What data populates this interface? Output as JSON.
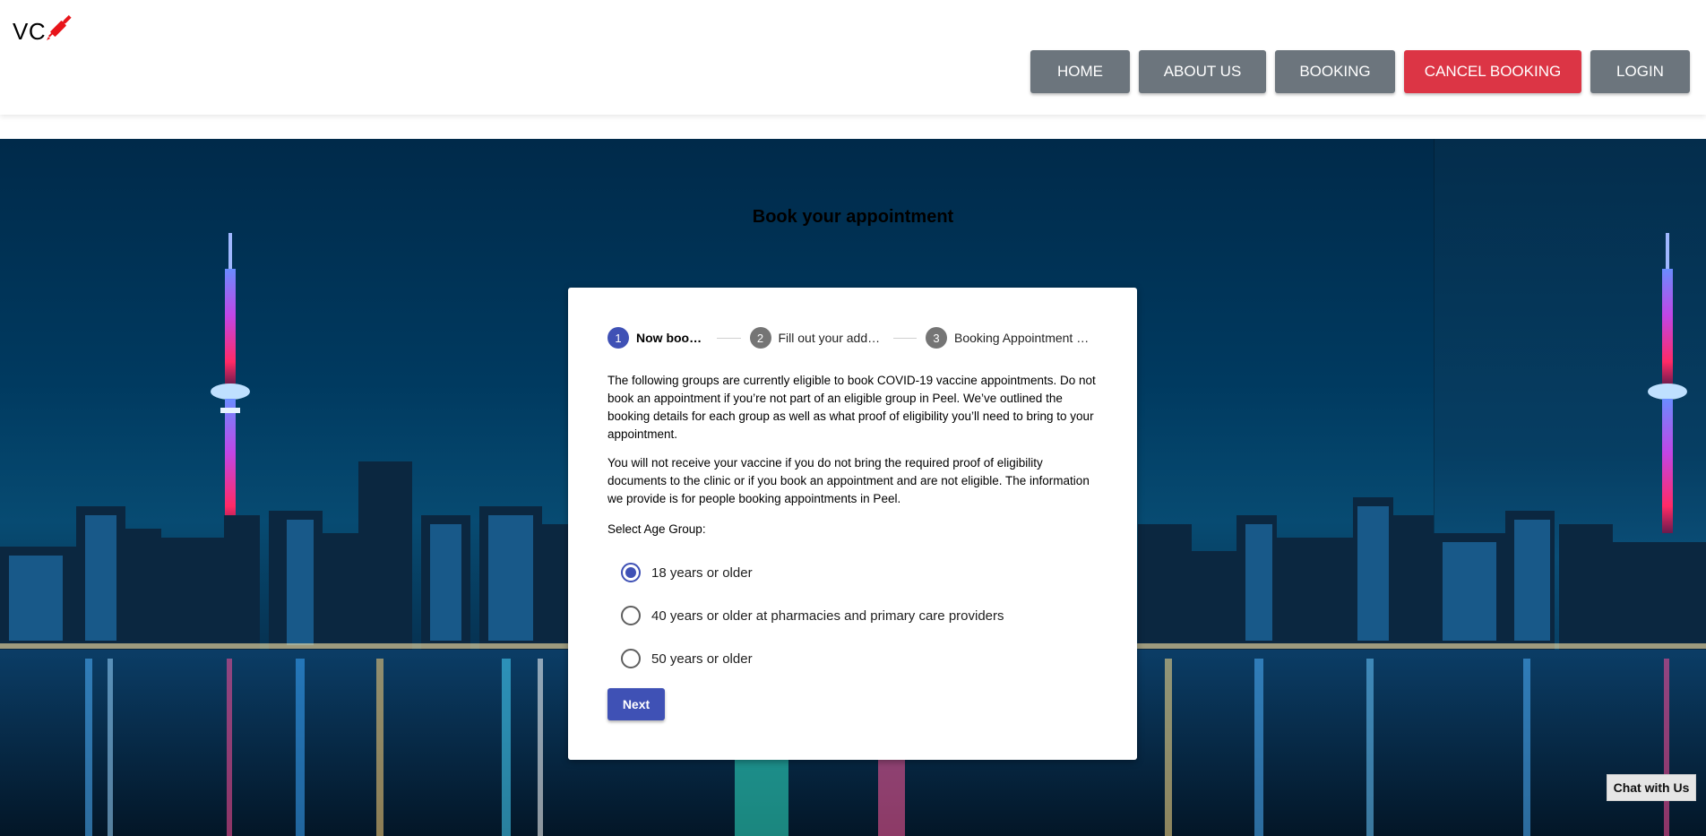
{
  "brand": {
    "logo_text": "VC",
    "logo_icon": "syringe-icon",
    "logo_icon_color": "#e8141a"
  },
  "nav": {
    "home": "HOME",
    "about": "ABOUT US",
    "booking": "BOOKING",
    "cancel": "CANCEL BOOKING",
    "login": "LOGIN"
  },
  "colors": {
    "nav_gray": "#6c757d",
    "nav_danger": "#dc3545",
    "primary": "#3f51b5"
  },
  "page": {
    "title": "Book your appointment"
  },
  "stepper": {
    "steps": [
      {
        "number": "1",
        "label": "Now booking",
        "active": true
      },
      {
        "number": "2",
        "label": "Fill out your address",
        "active": false
      },
      {
        "number": "3",
        "label": "Booking Appointment Details",
        "active": false
      }
    ]
  },
  "content": {
    "paragraph1": "The following groups are currently eligible to book COVID-19 vaccine appointments. Do not book an appointment if you’re not part of an eligible group in Peel. We’ve outlined the booking details for each group as well as what proof of eligibility you’ll need to bring to your appointment.",
    "paragraph2": "You will not receive your vaccine if you do not bring the required proof of eligibility documents to the clinic or if you book an appointment and are not eligible. The information we provide is for people booking appointments in Peel.",
    "age_group_label": "Select Age Group:",
    "age_options": [
      {
        "label": "18 years or older",
        "selected": true
      },
      {
        "label": "40 years or older at pharmacies and primary care providers",
        "selected": false
      },
      {
        "label": "50 years or older",
        "selected": false
      }
    ],
    "next_label": "Next"
  },
  "chat": {
    "label": "Chat with Us"
  }
}
